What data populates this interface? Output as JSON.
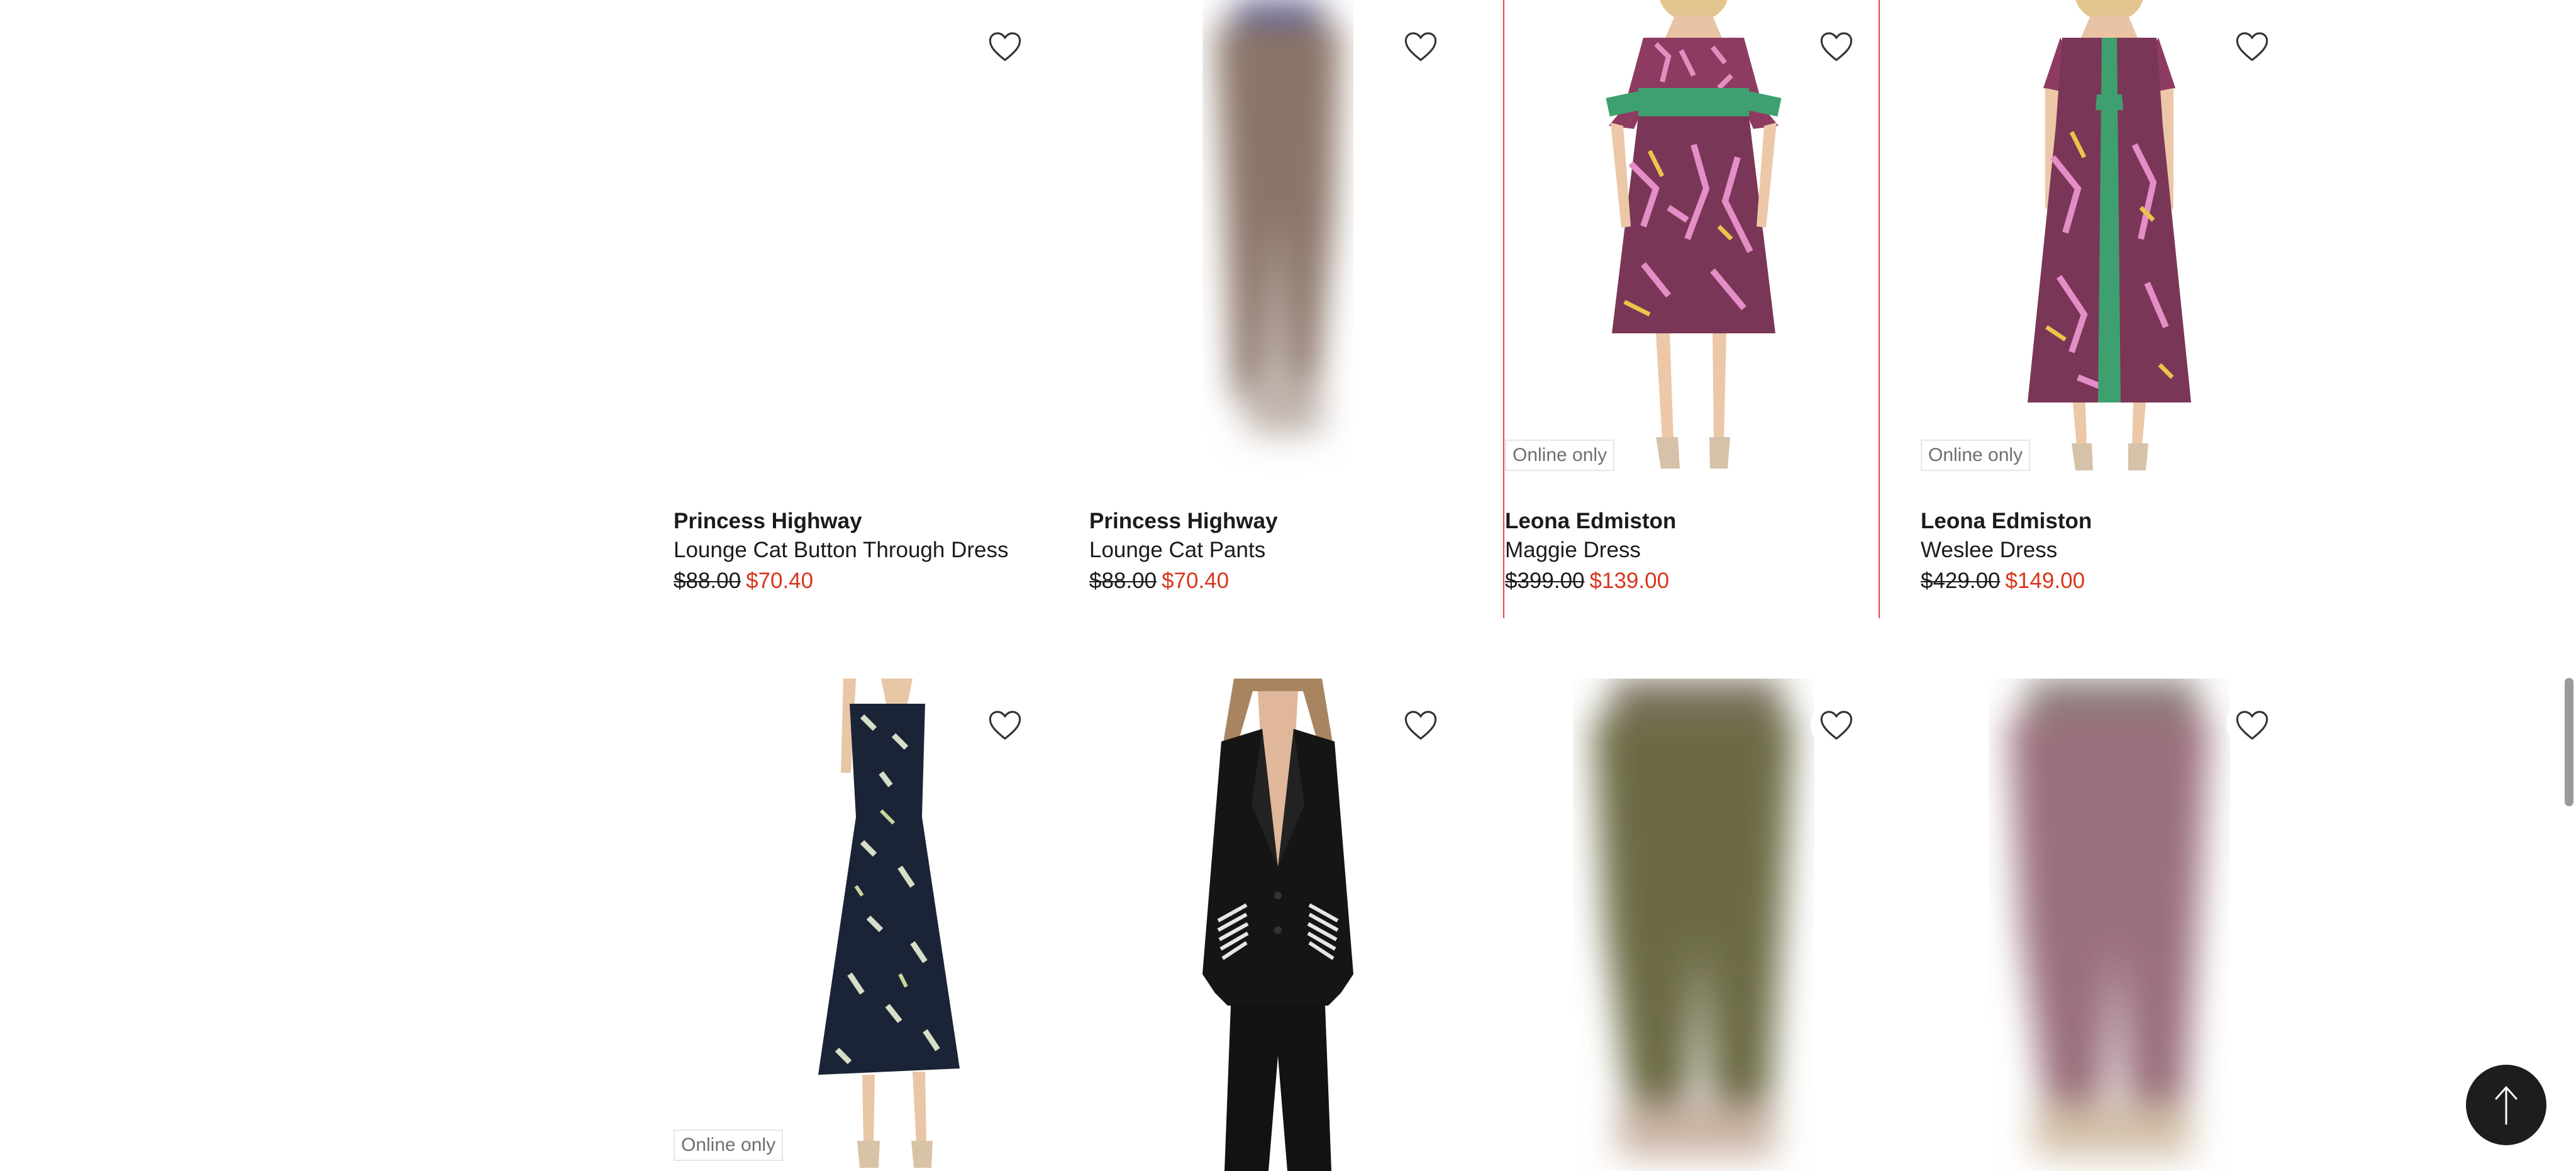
{
  "products": [
    {
      "brand": "Princess Highway",
      "name": "Lounge Cat Button Through Dress",
      "price_original": "$88.00",
      "price_sale": "$70.40",
      "badge": ""
    },
    {
      "brand": "Princess Highway",
      "name": "Lounge Cat Pants",
      "price_original": "$88.00",
      "price_sale": "$70.40",
      "badge": ""
    },
    {
      "brand": "Leona Edmiston",
      "name": "Maggie Dress",
      "price_original": "$399.00",
      "price_sale": "$139.00",
      "badge": "Online only"
    },
    {
      "brand": "Leona Edmiston",
      "name": "Weslee Dress",
      "price_original": "$429.00",
      "price_sale": "$149.00",
      "badge": "Online only"
    },
    {
      "brand": "",
      "name": "",
      "price_original": "",
      "price_sale": "",
      "badge": "Online only"
    },
    {
      "brand": "",
      "name": "",
      "price_original": "",
      "price_sale": "",
      "badge": ""
    },
    {
      "brand": "",
      "name": "",
      "price_original": "",
      "price_sale": "",
      "badge": ""
    },
    {
      "brand": "",
      "name": "",
      "price_original": "",
      "price_sale": "",
      "badge": ""
    }
  ],
  "icons": {
    "favorite": "heart-outline-icon",
    "back_to_top": "arrow-up-icon"
  },
  "colors": {
    "sale_price": "#d9361a",
    "hover_outline": "#e24b3b",
    "back_to_top_bg": "#1d1d1d"
  }
}
